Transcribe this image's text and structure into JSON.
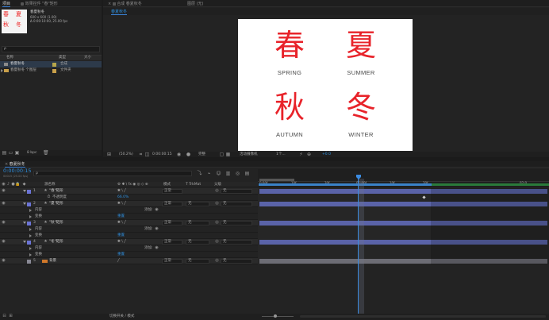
{
  "project": {
    "tab_label": "项目",
    "header_label": "效果控件 \"春\"矩形",
    "comp_name": "春夏秋冬",
    "comp_info_1": "600 x 600 (1.00)",
    "comp_info_2": "Δ 0:00:10:00, 25.00 fps",
    "search_placeholder": "ρ",
    "columns": [
      "名称",
      "类型",
      "大小"
    ],
    "items": [
      {
        "name": "春夏秋冬",
        "type": "合成"
      },
      {
        "name": "春夏秋冬 个图层",
        "type": "文件夹"
      }
    ],
    "thumb_chars": [
      "春",
      "夏",
      "秋",
      "冬"
    ],
    "footer_bpc": "8 bpc"
  },
  "viewer": {
    "tab_label": "合成 春夏秋冬",
    "layer_tab": "图层 (无)",
    "comp_tab": "春夏秋冬",
    "seasons": [
      {
        "glyph": "春",
        "label": "SPRING"
      },
      {
        "glyph": "夏",
        "label": "SUMMER"
      },
      {
        "glyph": "秋",
        "label": "AUTUMN"
      },
      {
        "glyph": "冬",
        "label": "WINTER"
      }
    ],
    "zoom": "(50.2%)",
    "timecode": "0:00:00:15",
    "quality": "完整",
    "camera": "活动摄像机",
    "views": "1个...",
    "offset": "+0.0"
  },
  "timeline": {
    "tab_label": "春夏秋冬",
    "timecode": "0:00:00:15",
    "frame_info": "00015 (25.00 fps)",
    "search_placeholder": "ρ",
    "col_source": "源名称",
    "col_mode": "模式",
    "col_trkmat": "T TrkMat",
    "col_parent": "父级",
    "ruler": [
      "0:00f",
      "10f",
      "20f",
      "01:00f",
      "10f",
      "20f",
      "02:0"
    ],
    "layers": [
      {
        "num": "1",
        "name": "\"春\"矩形",
        "mode": "正常",
        "parent": "无",
        "kind": "main"
      },
      {
        "num": "",
        "name": "不透明度",
        "value": "66.0%",
        "kind": "sub"
      },
      {
        "num": "2",
        "name": "\"夏\"矩形",
        "mode": "正常",
        "trkmat": "无",
        "parent": "无",
        "kind": "main"
      },
      {
        "num": "",
        "name": "内容",
        "add": "添加:",
        "kind": "sub"
      },
      {
        "num": "",
        "name": "变换",
        "reset": "重置",
        "kind": "sub"
      },
      {
        "num": "3",
        "name": "\"秋\"矩形",
        "mode": "正常",
        "trkmat": "无",
        "parent": "无",
        "kind": "main"
      },
      {
        "num": "",
        "name": "内容",
        "add": "添加:",
        "kind": "sub"
      },
      {
        "num": "",
        "name": "变换",
        "reset": "重置",
        "kind": "sub"
      },
      {
        "num": "4",
        "name": "\"冬\"矩形",
        "mode": "正常",
        "trkmat": "无",
        "parent": "无",
        "kind": "main"
      },
      {
        "num": "",
        "name": "内容",
        "add": "添加:",
        "kind": "sub"
      },
      {
        "num": "",
        "name": "变换",
        "reset": "重置",
        "kind": "sub"
      },
      {
        "num": "5",
        "name": "背景",
        "mode": "正常",
        "trkmat": "无",
        "parent": "无",
        "kind": "main"
      }
    ],
    "footer": "切换开关 / 模式"
  },
  "colors": {
    "accent": "#2e8fde",
    "layer_bar": "#5a63a8",
    "bg_bar": "#6c6c74",
    "season_red": "#e8232a"
  }
}
